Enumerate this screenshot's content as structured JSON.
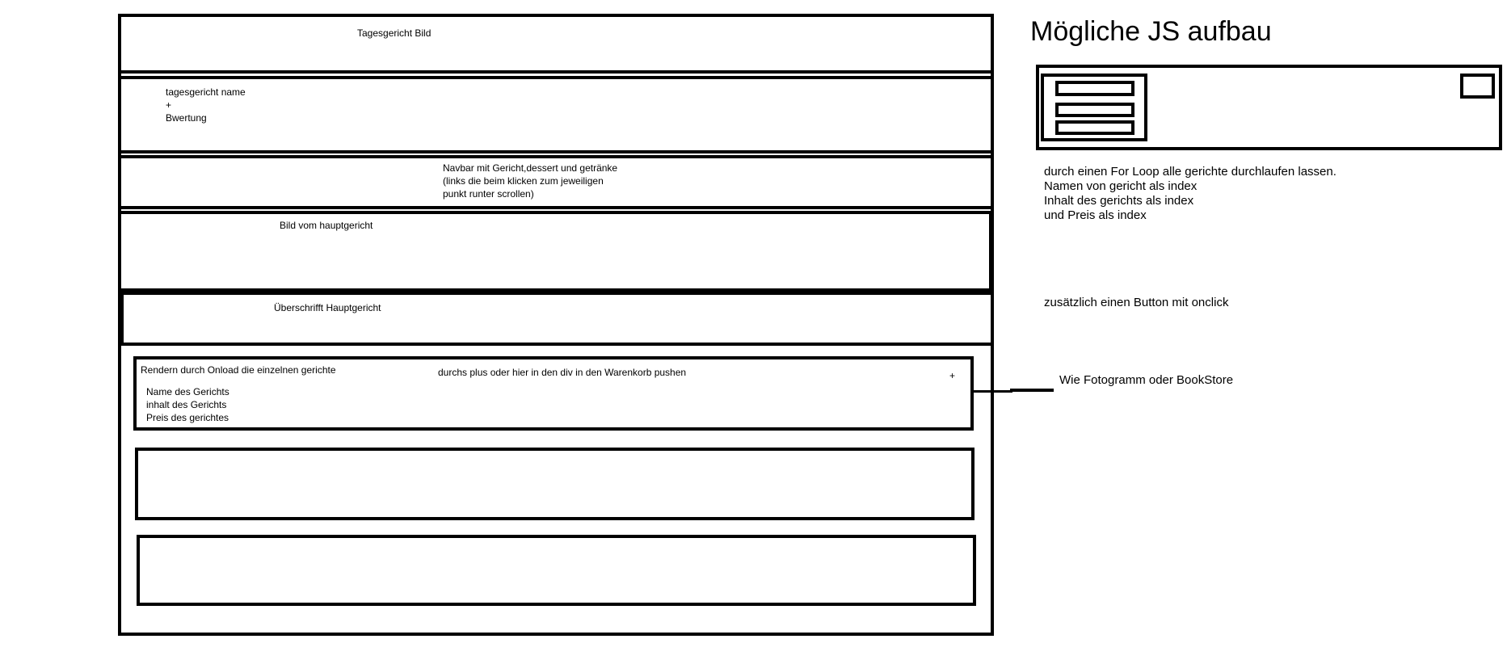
{
  "left": {
    "header_image": "Tagesgericht Bild",
    "dish_block": [
      "tagesgericht name",
      "+",
      "Bwertung"
    ],
    "navbar": [
      "Navbar mit Gericht,dessert und getränke",
      "(links die beim klicken zum jeweiligen",
      "punkt runter scrollen)"
    ],
    "main_image": "Bild vom hauptgericht",
    "main_heading": "Überschrifft Hauptgericht",
    "render_title": "Rendern durch Onload die einzelnen gerichte",
    "render_fields": [
      "Name des Gerichts",
      "inhalt des Gerichts",
      "Preis des gerichtes"
    ],
    "push_note": "durchs plus oder hier in den div in den Warenkorb pushen",
    "plus": "+"
  },
  "right": {
    "title": "Mögliche JS aufbau",
    "loop_note": [
      "durch einen For Loop alle gerichte durchlaufen lassen.",
      "Namen von gericht als index",
      "Inhalt des gerichts als index",
      "und Preis als index"
    ],
    "button_note": "zusätzlich einen Button mit onclick",
    "ref_note": "Wie Fotogramm oder BookStore"
  }
}
